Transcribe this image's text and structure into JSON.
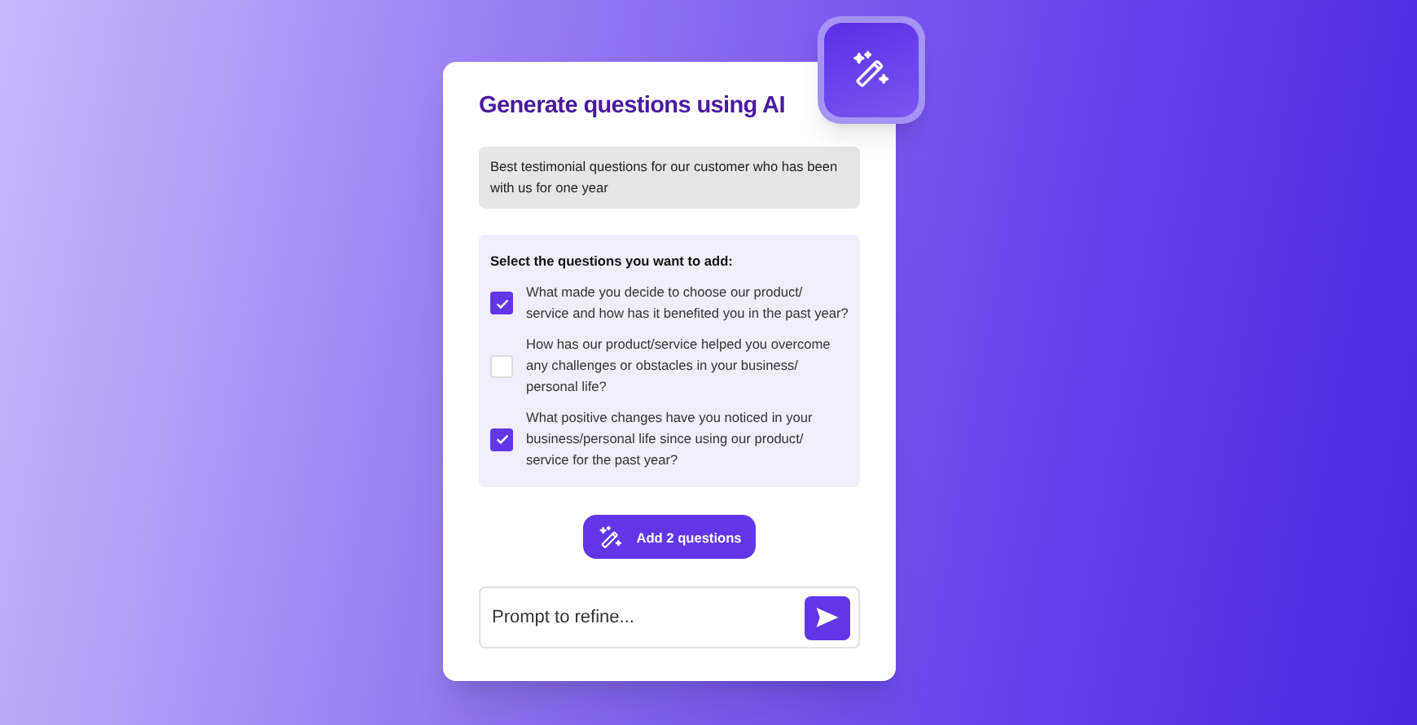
{
  "title": "Generate questions using AI",
  "prompt": "Best testimonial questions for our customer who has been with us for one year",
  "selection": {
    "heading": "Select the questions you want to add:",
    "questions": [
      {
        "text": "What made you decide to choose our product/ service and how has it benefited you in the past year?",
        "checked": true
      },
      {
        "text": "How has our product/service helped you overcome any challenges or obstacles in your business/ personal life?",
        "checked": false
      },
      {
        "text": "What positive changes have you noticed in your business/personal life since using our product/ service for the past year?",
        "checked": true
      }
    ]
  },
  "add_button": "Add 2 questions",
  "refine": {
    "placeholder": "Prompt to refine..."
  }
}
